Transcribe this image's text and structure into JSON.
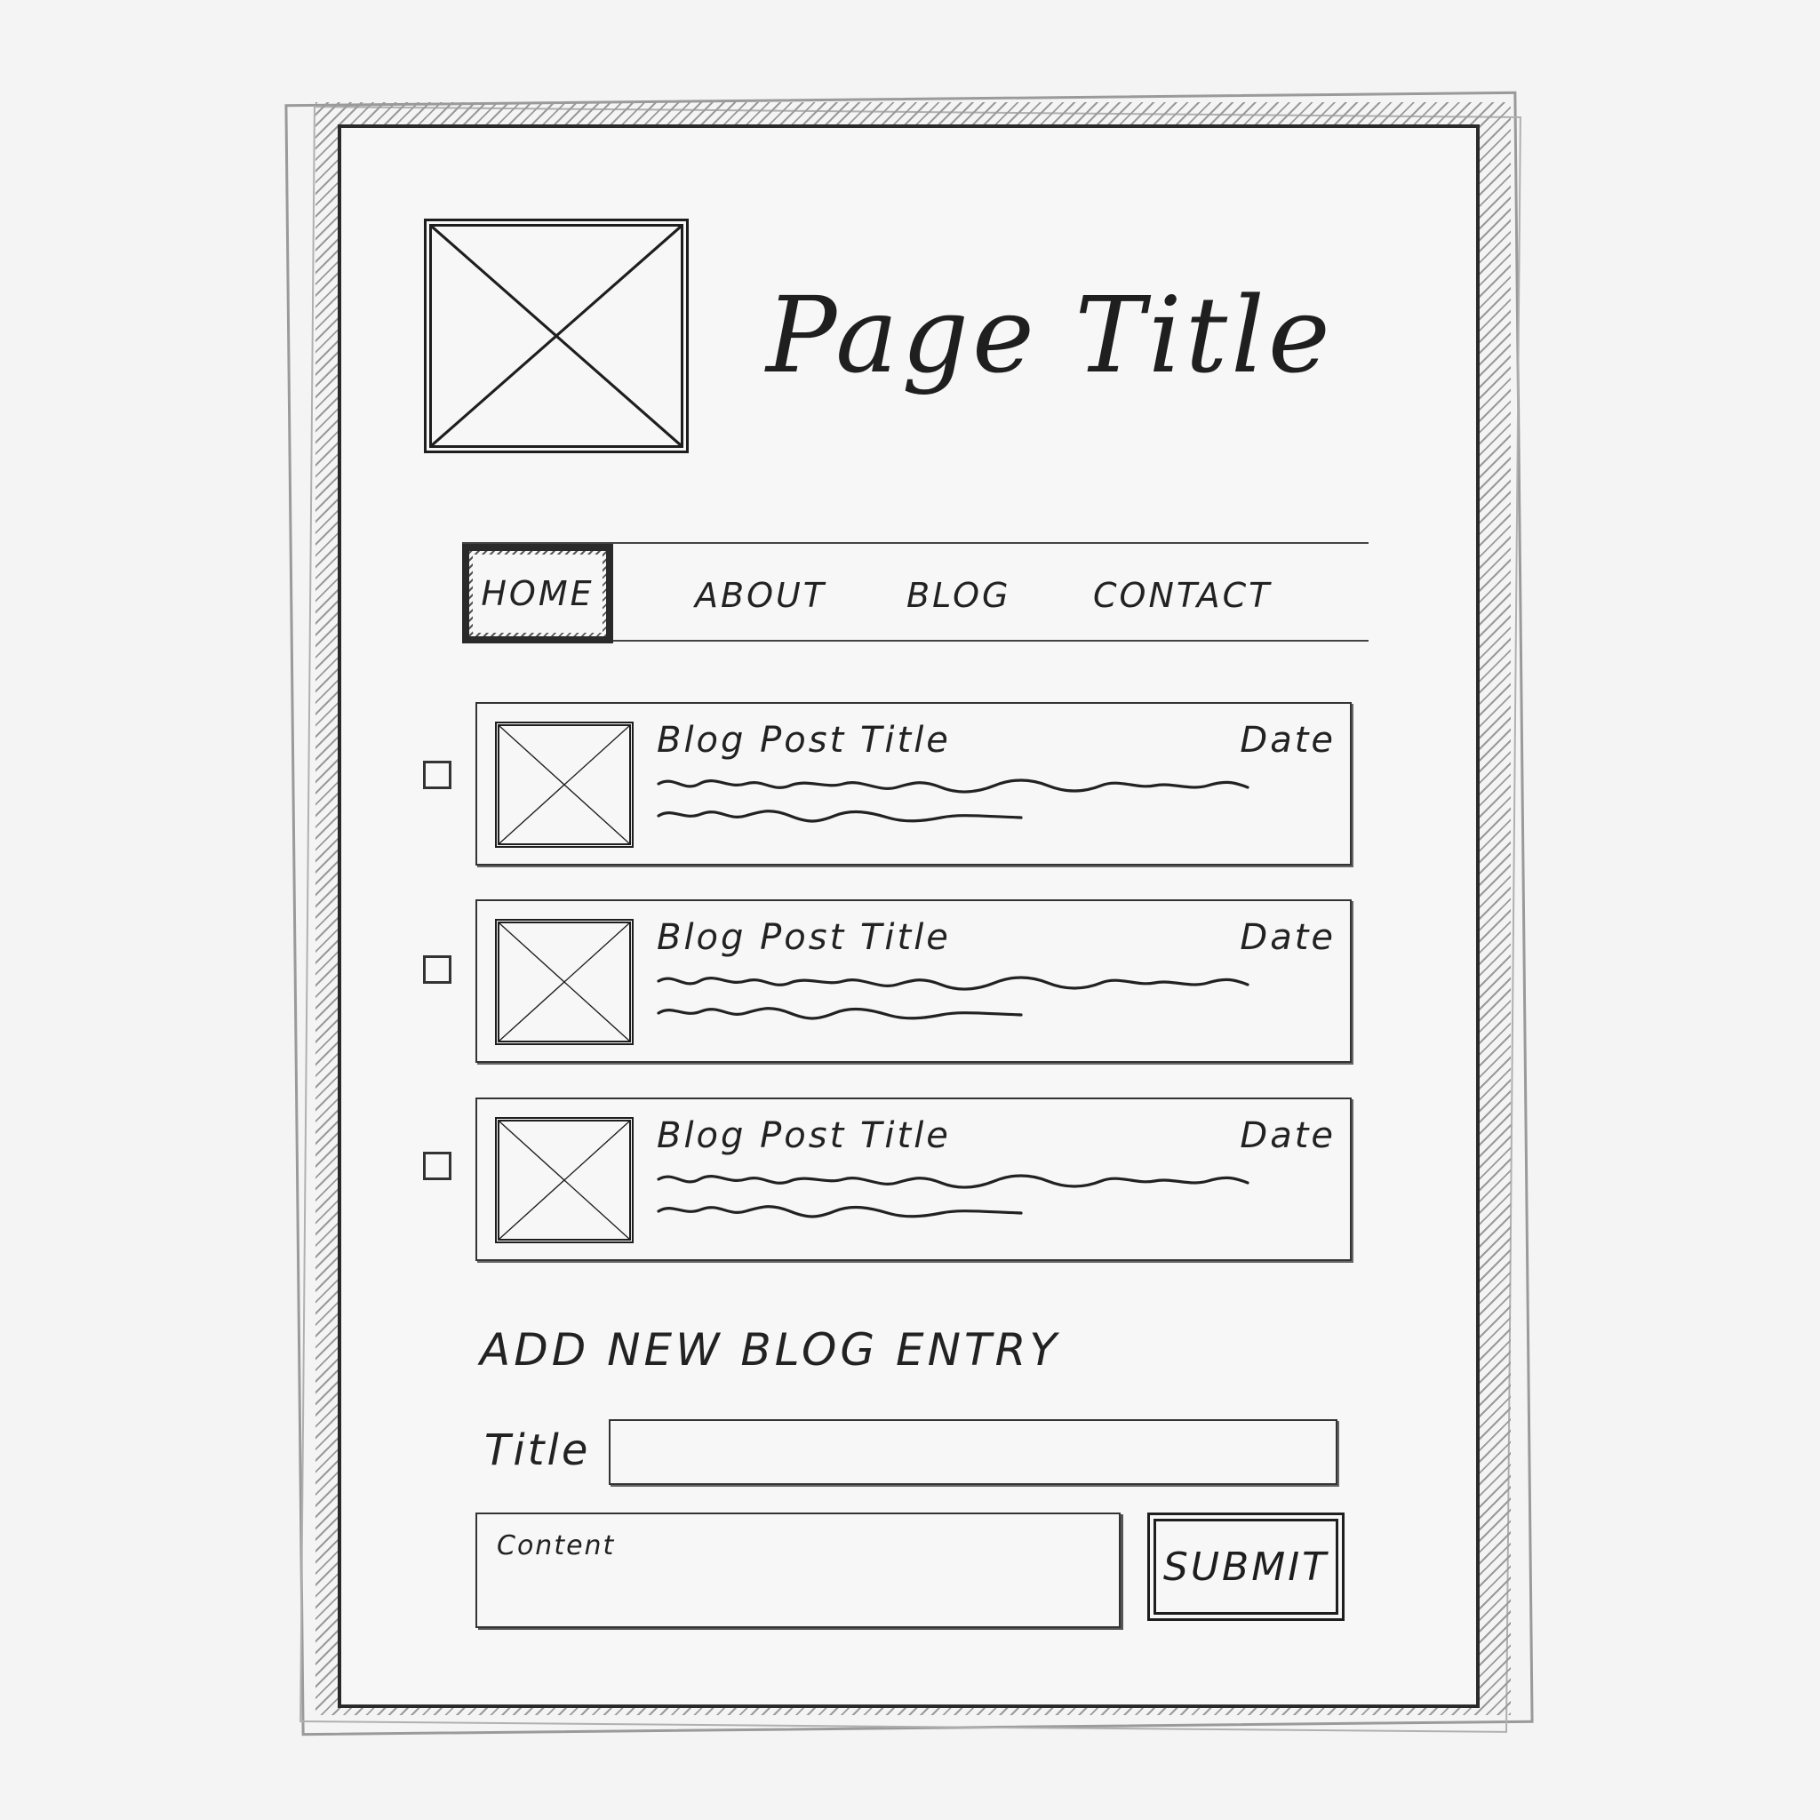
{
  "header": {
    "page_title": "Page Title",
    "logo_icon": "image-placeholder-icon"
  },
  "nav": {
    "items": [
      {
        "label": "HOME",
        "active": true
      },
      {
        "label": "ABOUT",
        "active": false
      },
      {
        "label": "BLOG",
        "active": false
      },
      {
        "label": "CONTACT",
        "active": false
      }
    ]
  },
  "posts": [
    {
      "title": "Blog Post Title",
      "date": "Date",
      "checked": false,
      "thumb_icon": "image-placeholder-icon"
    },
    {
      "title": "Blog Post Title",
      "date": "Date",
      "checked": false,
      "thumb_icon": "image-placeholder-icon"
    },
    {
      "title": "Blog Post Title",
      "date": "Date",
      "checked": false,
      "thumb_icon": "image-placeholder-icon"
    }
  ],
  "form": {
    "heading": "ADD NEW BLOG ENTRY",
    "title_label": "Title",
    "title_value": "",
    "content_placeholder": "Content",
    "submit_label": "SUBMIT"
  },
  "colors": {
    "ink": "#222222",
    "paper": "#f6f7f6",
    "background": "#f3f4f3"
  }
}
